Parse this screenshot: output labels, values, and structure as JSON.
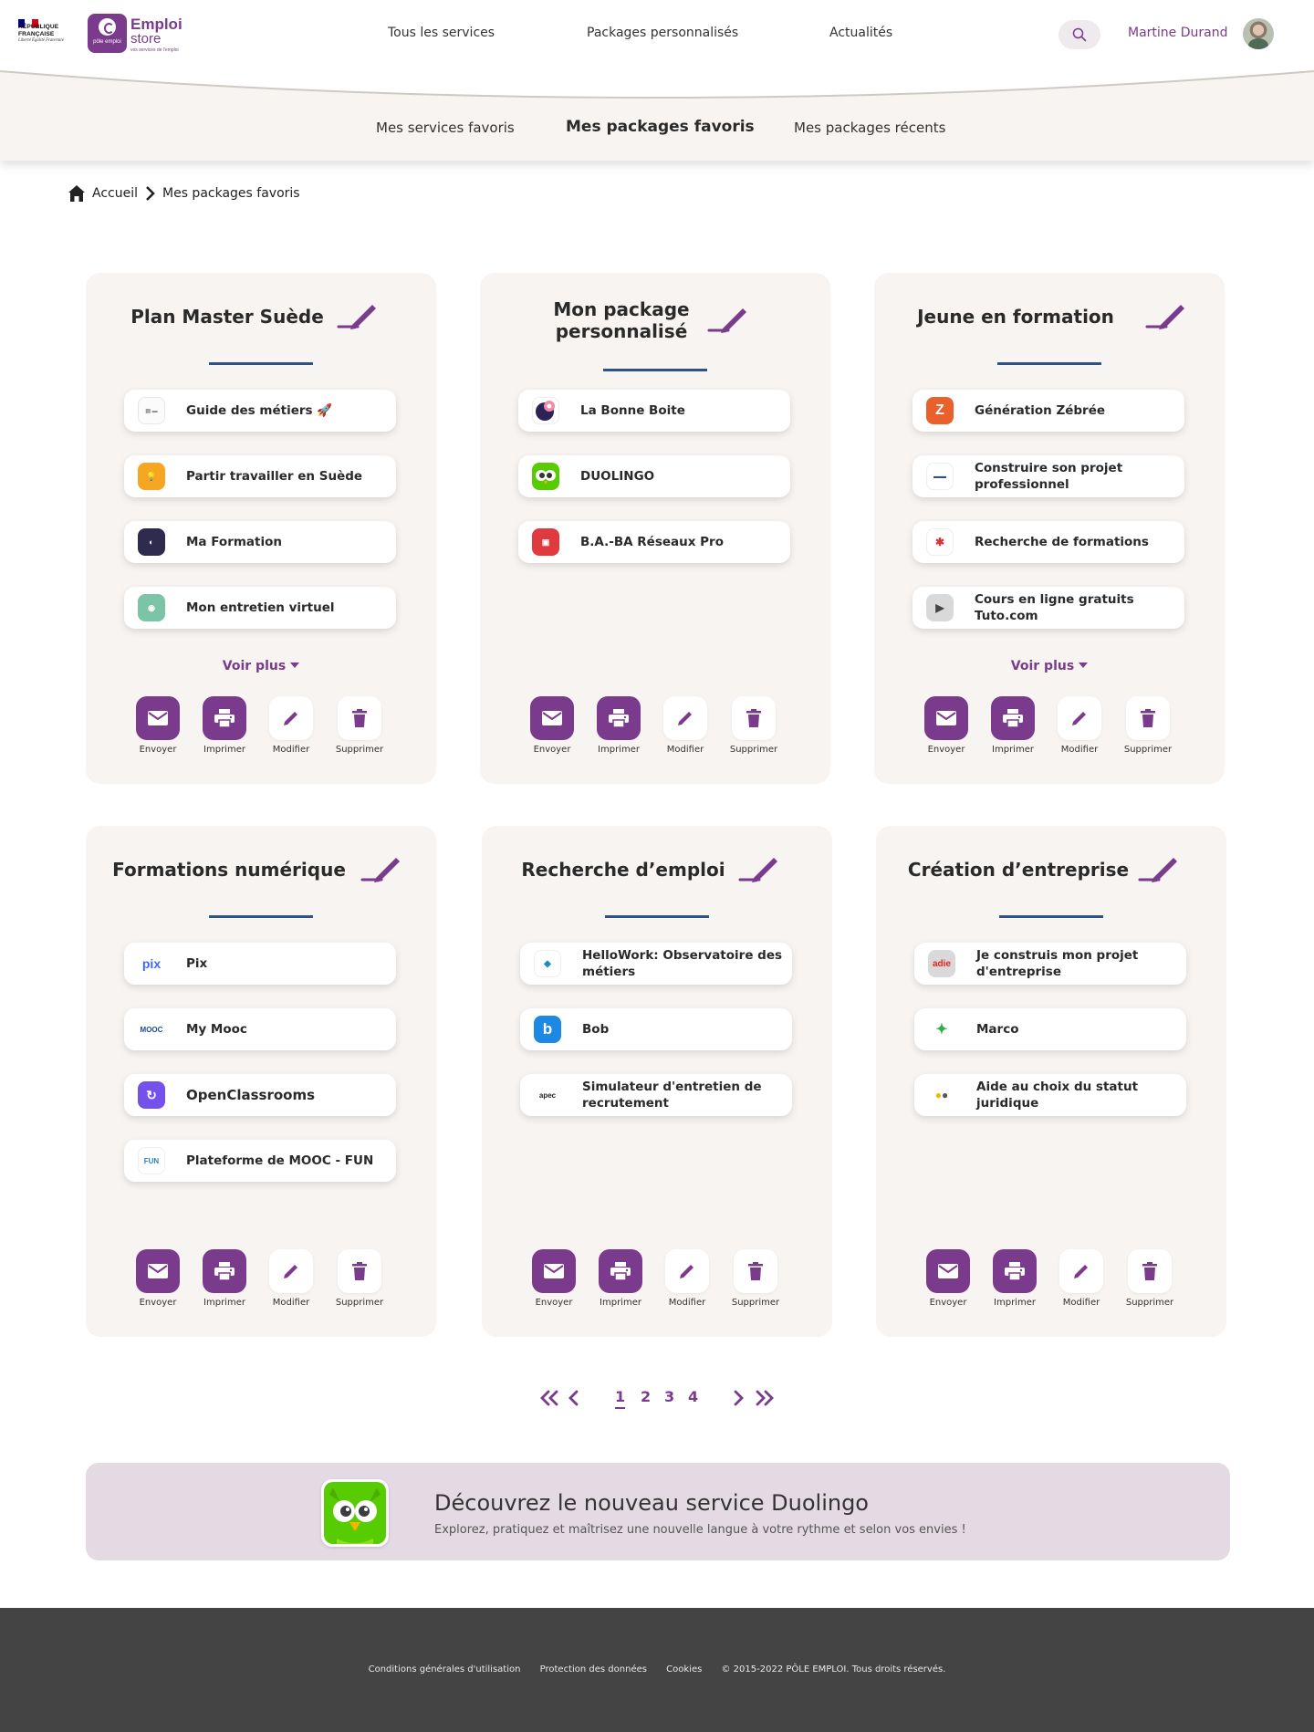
{
  "header": {
    "rf_logo": {
      "line1": "RÉPUBLIQUE",
      "line2": "FRANÇAISE",
      "motto": "Liberté Égalité Fraternité"
    },
    "brand": {
      "badge": "pôle emploi",
      "word1": "Emploi",
      "word2": "store",
      "tagline": "vos services de l'emploi",
      "color": "#7b3b8c"
    },
    "nav": [
      "Tous les services",
      "Packages personnalisés",
      "Actualités"
    ],
    "search_icon": "search-icon",
    "user": {
      "name": "Martine Durand"
    }
  },
  "subnav": {
    "items": [
      "Mes services favoris",
      "Mes packages favoris",
      "Mes packages récents"
    ],
    "active": "Mes packages favoris"
  },
  "breadcrumb": {
    "home": "Accueil",
    "current": "Mes packages favoris"
  },
  "actions": {
    "send": "Envoyer",
    "print": "Imprimer",
    "edit": "Modifier",
    "delete": "Supprimer"
  },
  "voir_plus": "Voir plus",
  "packages": [
    {
      "title": "Plan Master Suède",
      "items": [
        "Guide des métiers 🚀",
        "Partir travailler en Suède",
        "Ma Formation",
        "Mon entretien virtuel"
      ],
      "voir_plus": true
    },
    {
      "title": "Mon package personnalisé",
      "items": [
        "La Bonne Boite",
        "DUOLINGO",
        "B.A.-BA Réseaux Pro"
      ],
      "voir_plus": false
    },
    {
      "title": "Jeune en formation",
      "items": [
        "Génération Zébrée",
        "Construire son projet professionnel",
        "Recherche de formations",
        "Cours en ligne gratuits Tuto.com"
      ],
      "voir_plus": true
    },
    {
      "title": "Formations numérique",
      "items": [
        "Pix",
        "My Mooc",
        "OpenClassrooms",
        "Plateforme de MOOC - FUN"
      ],
      "voir_plus": false
    },
    {
      "title": "Recherche d’emploi",
      "items": [
        "HelloWork: Observatoire des métiers",
        "Bob",
        "Simulateur d'entretien de recrutement"
      ],
      "voir_plus": false
    },
    {
      "title": "Création d’entreprise",
      "items": [
        "Je construis mon projet d'entreprise",
        "Marco",
        "Aide au choix du statut juridique"
      ],
      "voir_plus": false
    }
  ],
  "pagination": {
    "pages": [
      "1",
      "2",
      "3",
      "4"
    ],
    "current": "1"
  },
  "promo": {
    "title": "Découvrez le nouveau service Duolingo",
    "subtitle": "Explorez, pratiquez et maîtrisez une nouvelle langue à votre rythme et selon vos envies !"
  },
  "footer": {
    "links": [
      "Conditions générales d'utilisation",
      "Protection des données",
      "Cookies",
      "© 2015-2022 PÔLE EMPLOI. Tous droits réservés."
    ]
  },
  "colors": {
    "accent": "#7b3b8c",
    "card_bg": "#f7f4f1",
    "underline": "#2b5385",
    "footer_bg": "#444444",
    "promo_bg": "#e4dae4"
  }
}
